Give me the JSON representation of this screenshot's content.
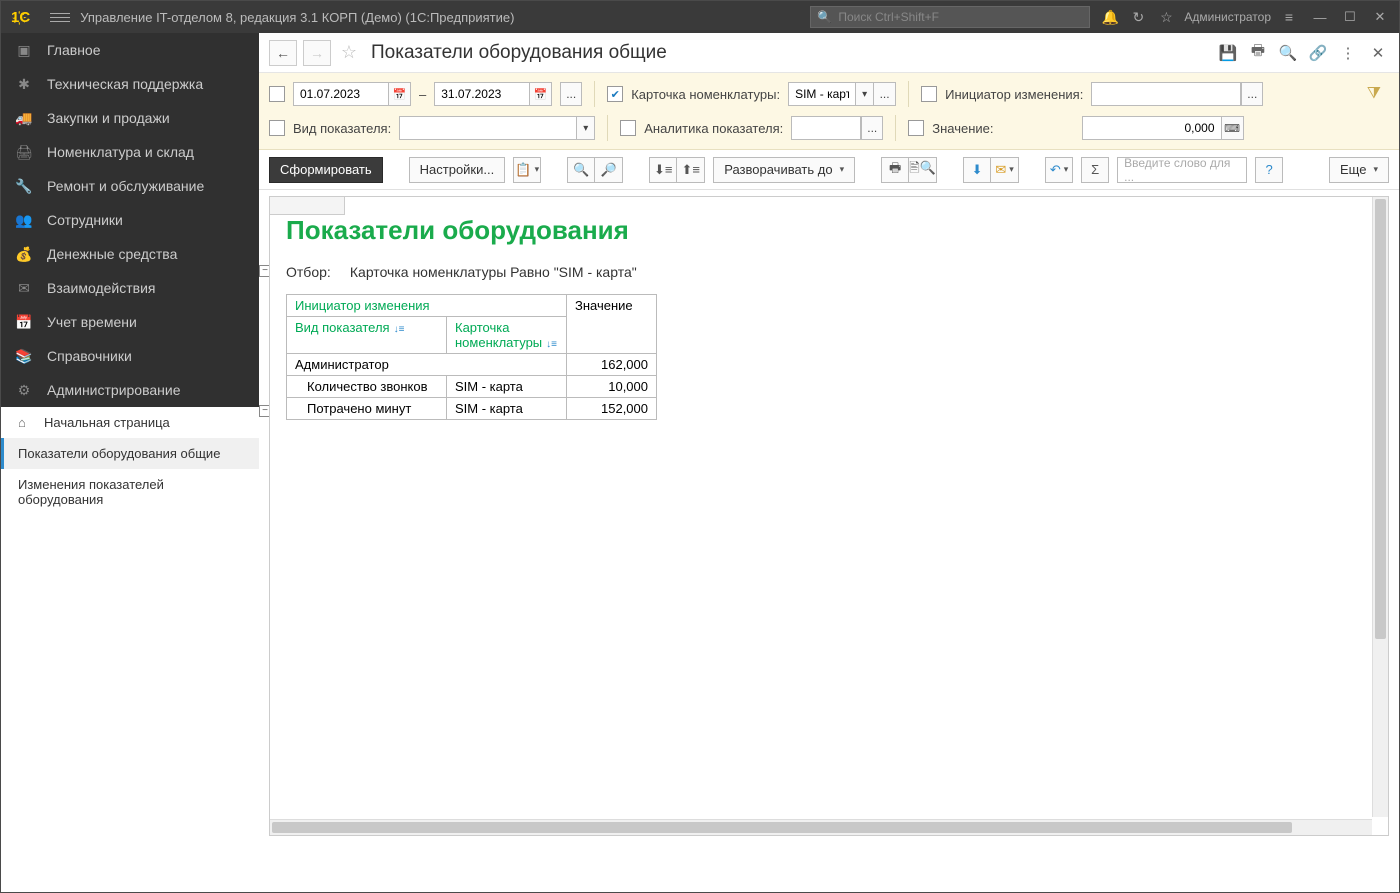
{
  "titlebar": {
    "app_title": "Управление IT-отделом 8, редакция 3.1 КОРП (Демо)  (1С:Предприятие)",
    "search_placeholder": "Поиск Ctrl+Shift+F",
    "user_label": "Администратор"
  },
  "sidebar": {
    "items": [
      {
        "icon": "▣",
        "label": "Главное"
      },
      {
        "icon": "✱",
        "label": "Техническая поддержка"
      },
      {
        "icon": "🚚",
        "label": "Закупки и продажи"
      },
      {
        "icon": "🖨",
        "label": "Номенклатура и склад"
      },
      {
        "icon": "🔧",
        "label": "Ремонт и обслуживание"
      },
      {
        "icon": "👥",
        "label": "Сотрудники"
      },
      {
        "icon": "💰",
        "label": "Денежные средства"
      },
      {
        "icon": "✉",
        "label": "Взаимодействия"
      },
      {
        "icon": "📅",
        "label": "Учет времени"
      },
      {
        "icon": "📚",
        "label": "Справочники"
      },
      {
        "icon": "⚙",
        "label": "Администрирование"
      }
    ],
    "sub": [
      {
        "icon": "⌂",
        "label": "Начальная страница"
      },
      {
        "icon": "",
        "label": "Показатели оборудования общие",
        "active": true
      },
      {
        "icon": "",
        "label": "Изменения показателей оборудования"
      }
    ]
  },
  "header": {
    "title": "Показатели оборудования общие"
  },
  "filters": {
    "date_from": "01.07.2023",
    "date_to": "31.07.2023",
    "dash": "–",
    "card_label": "Карточка номенклатуры:",
    "card_value": "SIM - карта",
    "initiator_label": "Инициатор изменения:",
    "type_label": "Вид показателя:",
    "analytic_label": "Аналитика показателя:",
    "value_label": "Значение:",
    "value_value": "0,000"
  },
  "toolbar": {
    "form": "Сформировать",
    "settings": "Настройки...",
    "expand": "Разворачивать до",
    "search_placeholder": "Введите слово для ...",
    "more": "Еще"
  },
  "report": {
    "title": "Показатели оборудования",
    "filter_key": "Отбор:",
    "filter_text": "Карточка номенклатуры Равно \"SIM - карта\"",
    "head": {
      "initiator": "Инициатор изменения",
      "value": "Значение",
      "type": "Вид показателя",
      "card": "Карточка номенклатуры"
    },
    "group": {
      "name": "Администратор",
      "total": "162,000"
    },
    "rows": [
      {
        "type": "Количество звонков",
        "card": "SIM - карта",
        "value": "10,000"
      },
      {
        "type": "Потрачено минут",
        "card": "SIM - карта",
        "value": "152,000"
      }
    ]
  }
}
